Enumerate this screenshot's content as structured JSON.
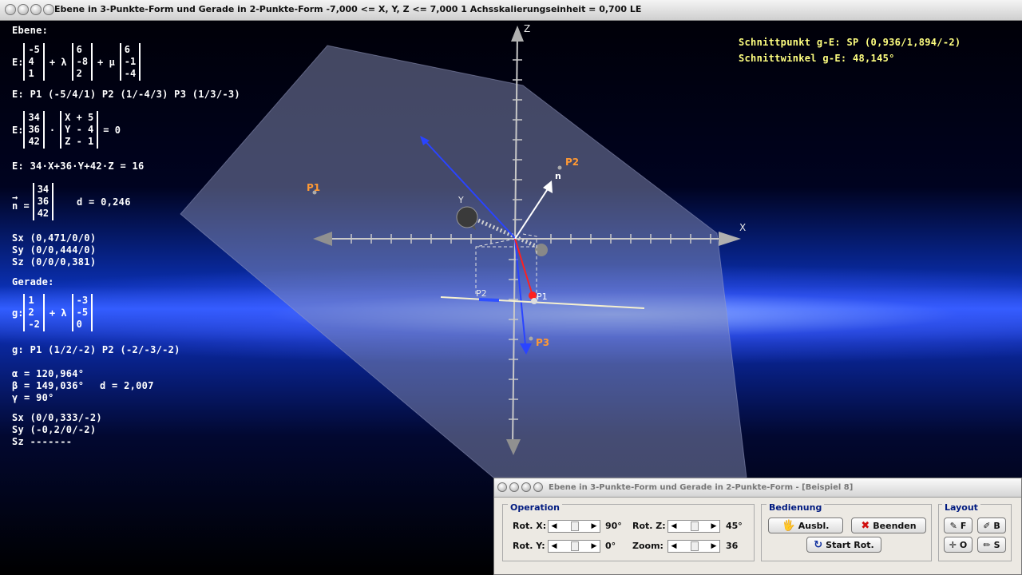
{
  "window": {
    "title": "Ebene in 3-Punkte-Form und Gerade in 2-Punkte-Form   -7,000 <= X, Y, Z <= 7,000   1 Achsskalierungseinheit = 0,700 LE"
  },
  "ebene": {
    "heading": "Ebene:",
    "param_prefix": "E:",
    "v0": [
      "-5",
      "4",
      "1"
    ],
    "lambda": "+ λ",
    "v1": [
      "6",
      "-8",
      "2"
    ],
    "mu": "+ μ",
    "v2": [
      "6",
      "-1",
      "-4"
    ],
    "points": "E: P1 (-5/4/1)   P2 (1/-4/3)   P3 (1/3/-3)",
    "normal_prefix": "E:",
    "normal": [
      "34",
      "36",
      "42"
    ],
    "dot": "·",
    "xvec": [
      "X + 5",
      "Y - 4",
      "Z - 1"
    ],
    "eq_zero": "= 0",
    "coord_eq": "E: 34·X+36·Y+42·Z = 16",
    "n_label": "n =",
    "n_arrow": "→",
    "n_vec": [
      "34",
      "36",
      "42"
    ],
    "d": "d = 0,246",
    "sx": "Sx (0,471/0/0)",
    "sy": "Sy (0/0,444/0)",
    "sz": "Sz (0/0/0,381)"
  },
  "gerade": {
    "heading": "Gerade:",
    "prefix": "g:",
    "v0": [
      "1",
      "2",
      "-2"
    ],
    "lambda": "+ λ",
    "v1": [
      "-3",
      "-5",
      "0"
    ],
    "points": "g: P1 (1/2/-2)   P2 (-2/-3/-2)",
    "alpha": "α = 120,964°",
    "beta": "β = 149,036°",
    "gamma": "γ = 90°",
    "d": "d = 2,007",
    "sx": "Sx (0/0,333/-2)",
    "sy": "Sy (-0,2/0/-2)",
    "sz": "Sz -------"
  },
  "result": {
    "schnittpunkt": "Schnittpunkt g-E: SP (0,936/1,894/-2)",
    "schnittwinkel": "Schnittwinkel g-E: 48,145°"
  },
  "scene_labels": {
    "z": "Z",
    "x": "X",
    "y": "Y",
    "n": "n",
    "p1_plane": "P1",
    "p2_plane": "P2",
    "p3_plane": "P3",
    "p1_line": "P1",
    "p2_line": "P2"
  },
  "colors": {
    "plane": "#8890b8",
    "axis": "#c8c8c8",
    "point_label": "#ff9933",
    "result_text": "#ffff80",
    "line_g": "#f5f0d0",
    "blue_vec": "#2040ff",
    "red_vec": "#ff2020"
  },
  "dialog": {
    "title": "Ebene in 3-Punkte-Form und Gerade in 2-Punkte-Form - [Beispiel 8]",
    "operation": {
      "label": "Operation",
      "rot_x_label": "Rot. X:",
      "rot_x_value": "90°",
      "rot_y_label": "Rot. Y:",
      "rot_y_value": "0°",
      "rot_z_label": "Rot. Z:",
      "rot_z_value": "45°",
      "zoom_label": "Zoom:",
      "zoom_value": "36"
    },
    "bedienung": {
      "label": "Bedienung",
      "ausbl": "Ausbl.",
      "beenden": "Beenden",
      "start_rot": "Start Rot."
    },
    "layout": {
      "label": "Layout",
      "f": "F",
      "b": "B",
      "o": "O",
      "s": "S"
    }
  }
}
